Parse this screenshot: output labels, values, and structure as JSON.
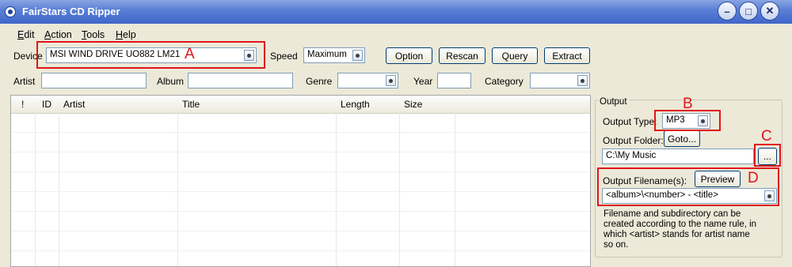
{
  "window": {
    "title": "FairStars CD Ripper"
  },
  "menu": [
    {
      "label": "Edit"
    },
    {
      "label": "Action"
    },
    {
      "label": "Tools"
    },
    {
      "label": "Help"
    }
  ],
  "device_row": {
    "device_label": "Device",
    "device_value": "MSI WIND DRIVE UO882 LM21",
    "speed_label": "Speed",
    "speed_value": "Maximum",
    "buttons": {
      "option": "Option",
      "rescan": "Rescan",
      "query": "Query",
      "extract": "Extract"
    }
  },
  "tags_row": {
    "artist_label": "Artist",
    "album_label": "Album",
    "genre_label": "Genre",
    "year_label": "Year",
    "category_label": "Category",
    "artist_value": "",
    "album_value": "",
    "genre_value": "",
    "year_value": "",
    "category_value": ""
  },
  "track_table": {
    "columns": [
      "!",
      "ID",
      "Artist",
      "Title",
      "Length",
      "Size"
    ],
    "rows": []
  },
  "output": {
    "group_title": "Output",
    "type_label": "Output Type:",
    "type_value": "MP3",
    "folder_label": "Output Folder:",
    "goto_button": "Goto...",
    "folder_value": "C:\\My Music",
    "browse_button": "...",
    "filename_label": "Output Filename(s):",
    "preview_button": "Preview",
    "filename_value": "<album>\\<number> - <title>",
    "help_text": [
      "Filename and subdirectory can be",
      "created according to the name rule, in",
      "which <artist> stands for artist name",
      "so on."
    ]
  },
  "annotations": {
    "a": "A",
    "b": "B",
    "c": "C",
    "d": "D",
    "color": "#e0141b"
  }
}
